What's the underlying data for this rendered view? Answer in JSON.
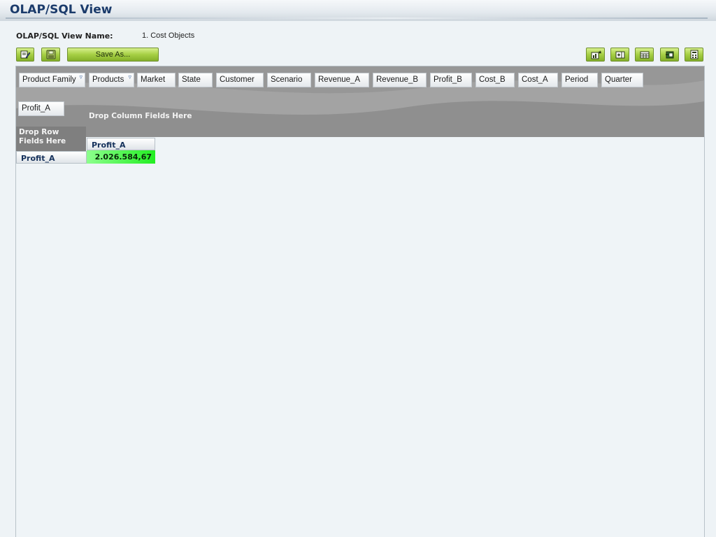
{
  "window": {
    "title": "OLAP/SQL View"
  },
  "view_name": {
    "label": "OLAP/SQL View Name:",
    "value": "1. Cost Objects"
  },
  "toolbar": {
    "save_as_label": "Save As...",
    "left_icons": [
      "edit-icon",
      "save-icon"
    ],
    "right_icons": [
      "new-chart-icon",
      "add-column-icon",
      "grid-icon",
      "export-icon",
      "calculator-icon"
    ],
    "accent_color": "#a6cf44"
  },
  "pivot": {
    "fields": [
      {
        "label": "Product Family",
        "filter_icon": "▿"
      },
      {
        "label": "Products",
        "filter_icon": "▿"
      },
      {
        "label": "Market"
      },
      {
        "label": "State"
      },
      {
        "label": "Customer"
      },
      {
        "label": "Scenario"
      },
      {
        "label": "Revenue_A"
      },
      {
        "label": "Revenue_B"
      },
      {
        "label": "Profit_B"
      },
      {
        "label": "Cost_B"
      },
      {
        "label": "Cost_A"
      },
      {
        "label": "Period"
      },
      {
        "label": "Quarter"
      }
    ],
    "data_field": "Profit_A",
    "drop_column_text": "Drop Column Fields Here",
    "drop_row_text": "Drop Row Fields Here",
    "column_header": "Profit_A",
    "row_header": "Profit_A",
    "value": "2.026.584,67",
    "value_color": "#22ee22"
  }
}
